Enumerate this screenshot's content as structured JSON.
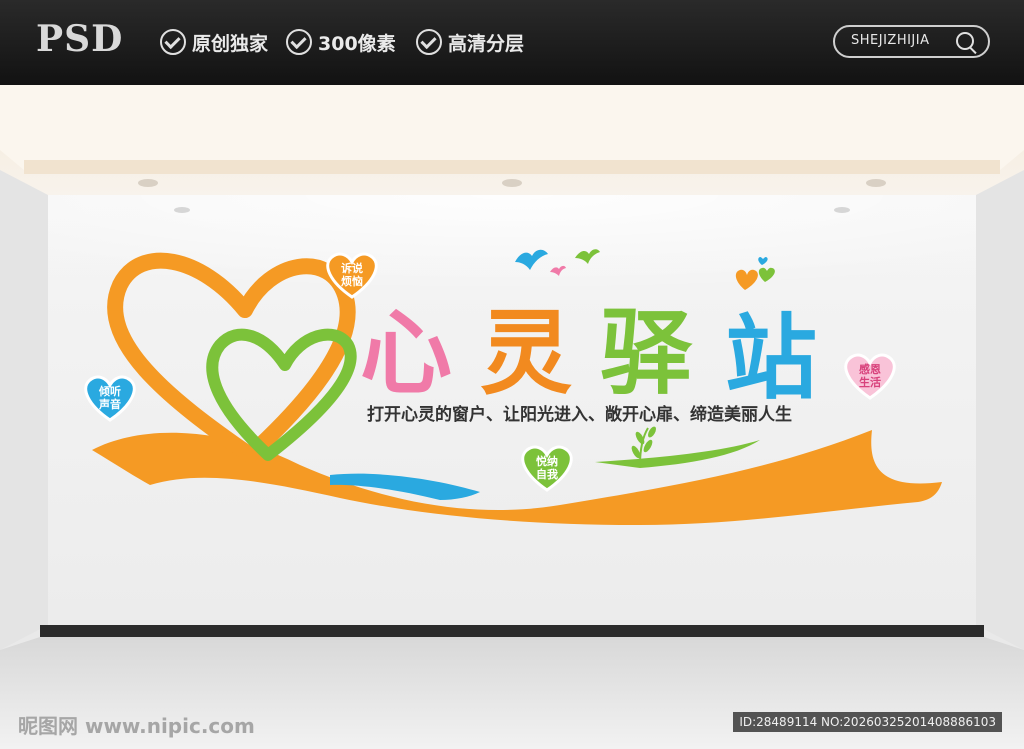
{
  "header": {
    "brand": "PSD",
    "features": [
      "原创独家",
      "300像素",
      "高清分层"
    ],
    "search_label": "SHEJIZHIJIA"
  },
  "sign": {
    "title_chars": [
      "心",
      "灵",
      "驿",
      "站"
    ],
    "title_colors": [
      "#f07aa8",
      "#f28a1f",
      "#7cc23a",
      "#2aa9e0"
    ],
    "slogan": "打开心灵的窗户、让阳光进入、敞开心扉、缔造美丽人生",
    "bubbles": [
      {
        "text": "诉说烦恼",
        "color": "#f28a1f"
      },
      {
        "text": "倾听声音",
        "color": "#2aa9e0"
      },
      {
        "text": "悦纳自我",
        "color": "#7cc23a"
      },
      {
        "text": "感恩生活",
        "color": "#f07aa8"
      }
    ]
  },
  "watermark": "昵图网 www.nipic.com",
  "image_id": "ID:28489114 NO:20260325201408886103"
}
